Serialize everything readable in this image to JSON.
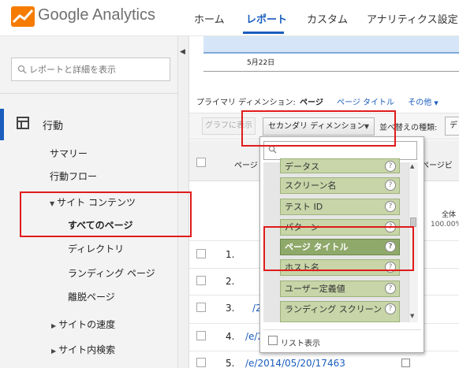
{
  "header": {
    "brand_text": "Google Analytics",
    "tabs": [
      {
        "label": "ホーム"
      },
      {
        "label": "レポート"
      },
      {
        "label": "カスタム"
      },
      {
        "label": "アナリティクス設定"
      }
    ],
    "active_tab": "レポート",
    "accent_color": "#1a5dbd"
  },
  "sidebar": {
    "search_placeholder": "レポートと詳細を表示",
    "section": "行動",
    "items": [
      {
        "label": "サマリー"
      },
      {
        "label": "行動フロー"
      },
      {
        "label": "サイト コンテンツ",
        "expanded": true
      },
      {
        "label": "すべてのページ",
        "selected": true
      },
      {
        "label": "ディレクトリ"
      },
      {
        "label": "ランディング ページ"
      },
      {
        "label": "離脱ページ"
      },
      {
        "label": "サイトの速度",
        "expanded": false
      },
      {
        "label": "サイト内検索",
        "expanded": false
      }
    ]
  },
  "chart": {
    "date_label": "5月22日"
  },
  "dimensions": {
    "primary_label": "プライマリ ディメンション:",
    "primary_value": "ページ",
    "alt_link": "ページ タイトル",
    "other_link": "その他",
    "other_caret": "▼"
  },
  "toolbar": {
    "graph_button": "グラフに表示",
    "secondary_button": "セカンダリ ディメンション",
    "caret": "▼",
    "sort_label": "並べ替えの種類:",
    "sort_value": "デ"
  },
  "table": {
    "col_page": "ページ",
    "col_views": "ページビ",
    "total_label": "全体",
    "total_value": "100.00%",
    "rows": [
      {
        "num": "1.",
        "link": ""
      },
      {
        "num": "2.",
        "link": ""
      },
      {
        "num": "3.",
        "link": "/2"
      },
      {
        "num": "4.",
        "link": "/e/2"
      },
      {
        "num": "5.",
        "link": "/e/2014/05/20/17463"
      }
    ]
  },
  "dropdown": {
    "items": [
      {
        "label": "データス"
      },
      {
        "label": "スクリーン名"
      },
      {
        "label": "テスト ID"
      },
      {
        "label": "パターン"
      },
      {
        "label": "ページ タイトル",
        "selected": true
      },
      {
        "label": "ホスト名"
      },
      {
        "label": "ユーザー定義値"
      },
      {
        "label": "ランディング スクリーン"
      }
    ],
    "help_glyph": "?",
    "list_view_label": "リスト表示"
  }
}
